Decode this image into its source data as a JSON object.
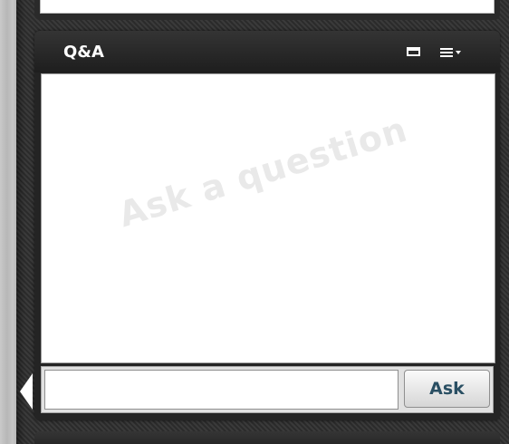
{
  "qa_panel": {
    "title": "Q&A",
    "watermark": "Ask a question",
    "input": {
      "value": "",
      "placeholder": ""
    },
    "ask_label": "Ask",
    "icons": {
      "popout": "popout-window-icon",
      "menu": "list-menu-icon",
      "collapse": "collapse-arrow-icon"
    }
  },
  "colors": {
    "header_bg": "#242424",
    "title": "#ffffff",
    "ask_text": "#2a4f63",
    "watermark": "#e9e9e9"
  }
}
